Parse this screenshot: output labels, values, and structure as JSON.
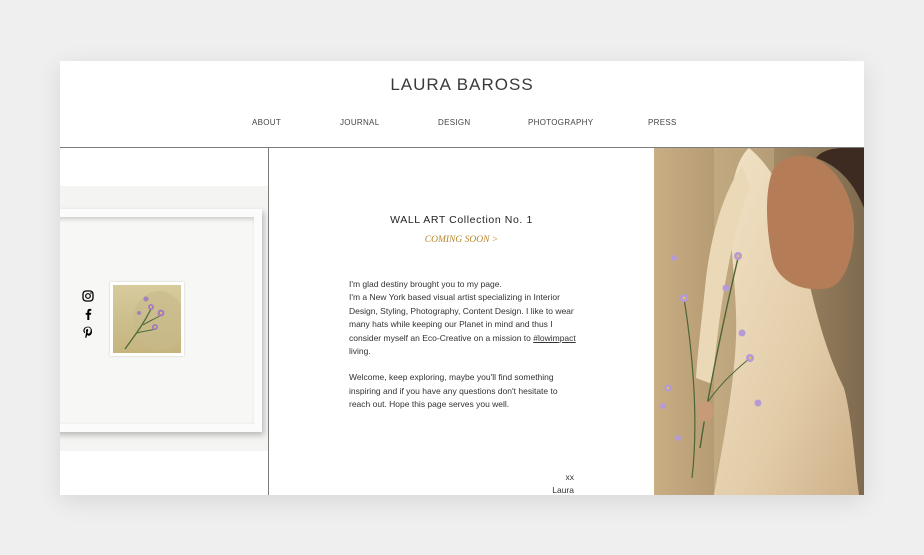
{
  "site": {
    "brand": "LAURA BAROSS",
    "nav": [
      "ABOUT",
      "JOURNAL",
      "DESIGN",
      "PHOTOGRAPHY",
      "PRESS"
    ]
  },
  "social": [
    "instagram-icon",
    "facebook-icon",
    "pinterest-icon"
  ],
  "main": {
    "title": "WALL ART Collection No. 1",
    "coming_soon": "COMING SOON >",
    "intro_1": "I'm glad destiny brought you to my page.",
    "intro_2a": "I'm a New York based visual artist specializing in Interior Design, Styling, Photography, Content Design. I like to wear many hats while keeping our Planet in mind and thus I consider myself an Eco-Creative on a mission to ",
    "intro_2_tag": "#lowimpact",
    "intro_2b": " living.",
    "welcome": "Welcome, keep exploring, maybe you'll find something inspiring and if you have any questions don't hesitate to reach out. Hope this page serves you well.",
    "sign_xx": "xx",
    "sign_name": "Laura"
  },
  "colors": {
    "accent": "#b8862b",
    "rule": "#7c7c7c",
    "background": "#efefef"
  }
}
